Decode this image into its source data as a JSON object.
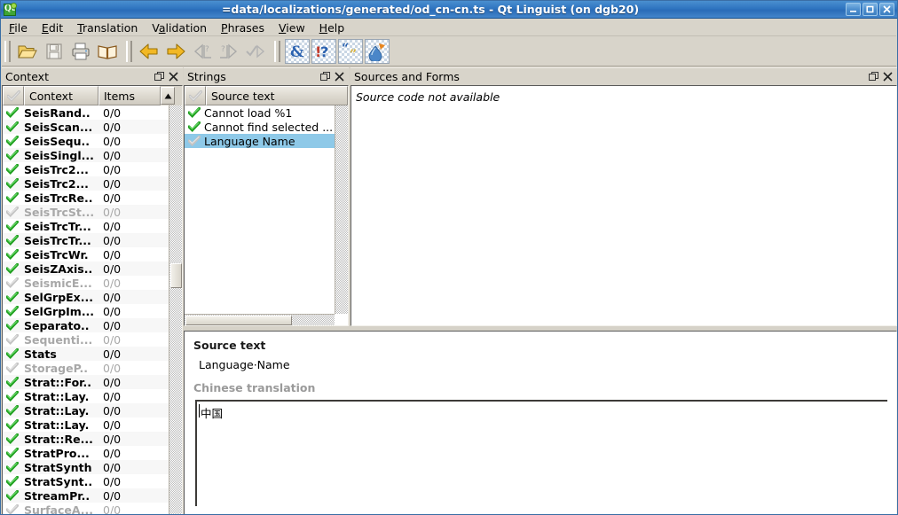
{
  "window": {
    "title": "=data/localizations/generated/od_cn-cn.ts - Qt Linguist (on dgb20)",
    "logo_text": "Qt",
    "minimize_label": "_",
    "maximize_label": "□",
    "close_label": "✕",
    "titlebar_color": "#2f75c0"
  },
  "menubar": {
    "items": [
      {
        "label": "File",
        "mnemonic": "F"
      },
      {
        "label": "Edit",
        "mnemonic": "E"
      },
      {
        "label": "Translation",
        "mnemonic": "T"
      },
      {
        "label": "Validation",
        "mnemonic": "a"
      },
      {
        "label": "Phrases",
        "mnemonic": "P"
      },
      {
        "label": "View",
        "mnemonic": "V"
      },
      {
        "label": "Help",
        "mnemonic": "H"
      }
    ]
  },
  "toolbar": {
    "groups": [
      {
        "buttons": [
          {
            "icon": "open-folder-icon",
            "name": "open-button",
            "enabled": true,
            "checked": false
          },
          {
            "icon": "save-disk-icon",
            "name": "save-button",
            "enabled": false,
            "checked": false
          },
          {
            "icon": "print-icon",
            "name": "print-button",
            "enabled": true,
            "checked": false
          },
          {
            "icon": "open-book-icon",
            "name": "open-phrase-book-button",
            "enabled": true,
            "checked": false
          }
        ]
      },
      {
        "buttons": [
          {
            "icon": "arrow-left-icon",
            "name": "prev-button",
            "enabled": true,
            "checked": false
          },
          {
            "icon": "arrow-right-icon",
            "name": "next-button",
            "enabled": true,
            "checked": false
          },
          {
            "icon": "prev-unfinished-icon",
            "name": "prev-unfinished-button",
            "enabled": false,
            "checked": false
          },
          {
            "icon": "next-unfinished-icon",
            "name": "next-unfinished-button",
            "enabled": false,
            "checked": false
          },
          {
            "icon": "done-and-next-icon",
            "name": "done-and-next-button",
            "enabled": false,
            "checked": false
          }
        ]
      },
      {
        "buttons": [
          {
            "icon": "accelerator-validation-icon",
            "name": "accelerator-validation-toggle",
            "enabled": true,
            "checked": true
          },
          {
            "icon": "punctuation-validation-icon",
            "name": "punctuation-validation-toggle",
            "enabled": true,
            "checked": true
          },
          {
            "icon": "phrase-validation-icon",
            "name": "phrase-validation-toggle",
            "enabled": true,
            "checked": true
          },
          {
            "icon": "placemarker-validation-icon",
            "name": "placemarker-validation-toggle",
            "enabled": true,
            "checked": true
          }
        ]
      }
    ]
  },
  "context_panel": {
    "title": "Context",
    "float_label": "❐",
    "close_label": "✕",
    "columns": [
      "",
      "Context",
      "Items"
    ],
    "rows": [
      {
        "name": "SeisRand..",
        "items": "0/0",
        "done": true
      },
      {
        "name": "SeisScan...",
        "items": "0/0",
        "done": true
      },
      {
        "name": "SeisSequ..",
        "items": "0/0",
        "done": true
      },
      {
        "name": "SeisSingl...",
        "items": "0/0",
        "done": true
      },
      {
        "name": "SeisTrc2...",
        "items": "0/0",
        "done": true
      },
      {
        "name": "SeisTrc2...",
        "items": "0/0",
        "done": true
      },
      {
        "name": "SeisTrcRe..",
        "items": "0/0",
        "done": true
      },
      {
        "name": "SeisTrcSt...",
        "items": "0/0",
        "done": false
      },
      {
        "name": "SeisTrcTr...",
        "items": "0/0",
        "done": true
      },
      {
        "name": "SeisTrcTr...",
        "items": "0/0",
        "done": true
      },
      {
        "name": "SeisTrcWr.",
        "items": "0/0",
        "done": true
      },
      {
        "name": "SeisZAxis..",
        "items": "0/0",
        "done": true
      },
      {
        "name": "SeismicE...",
        "items": "0/0",
        "done": false
      },
      {
        "name": "SelGrpEx...",
        "items": "0/0",
        "done": true
      },
      {
        "name": "SelGrpIm...",
        "items": "0/0",
        "done": true
      },
      {
        "name": "Separato..",
        "items": "0/0",
        "done": true
      },
      {
        "name": "Sequenti...",
        "items": "0/0",
        "done": false
      },
      {
        "name": "Stats",
        "items": "0/0",
        "done": true
      },
      {
        "name": "StorageP..",
        "items": "0/0",
        "done": false
      },
      {
        "name": "Strat::For..",
        "items": "0/0",
        "done": true
      },
      {
        "name": "Strat::Lay.",
        "items": "0/0",
        "done": true
      },
      {
        "name": "Strat::Lay.",
        "items": "0/0",
        "done": true
      },
      {
        "name": "Strat::Lay.",
        "items": "0/0",
        "done": true
      },
      {
        "name": "Strat::Re...",
        "items": "0/0",
        "done": true
      },
      {
        "name": "StratPro...",
        "items": "0/0",
        "done": true
      },
      {
        "name": "StratSynth",
        "items": "0/0",
        "done": true
      },
      {
        "name": "StratSynt..",
        "items": "0/0",
        "done": true
      },
      {
        "name": "StreamPr..",
        "items": "0/0",
        "done": true
      },
      {
        "name": "SurfaceA...",
        "items": "0/0",
        "done": false
      }
    ]
  },
  "strings_panel": {
    "title": "Strings",
    "float_label": "❐",
    "close_label": "✕",
    "column_header": "Source text",
    "rows": [
      {
        "text": "Cannot load %1",
        "done": true,
        "selected": false
      },
      {
        "text": "Cannot find selected ...",
        "done": true,
        "selected": false
      },
      {
        "text": "Language Name",
        "done": false,
        "selected": true
      }
    ]
  },
  "sources_panel": {
    "title": "Sources and Forms",
    "float_label": "❐",
    "close_label": "✕",
    "body_text": "Source code not available"
  },
  "editor": {
    "source_label": "Source text",
    "source_value": "Language·Name",
    "translation_label": "Chinese translation",
    "translation_value": "中国"
  },
  "colors": {
    "selection": "#8ec9e8",
    "panel_bg": "#d8d4ca",
    "check_green": "#2fb62f",
    "check_grey": "#b4b4b4"
  }
}
